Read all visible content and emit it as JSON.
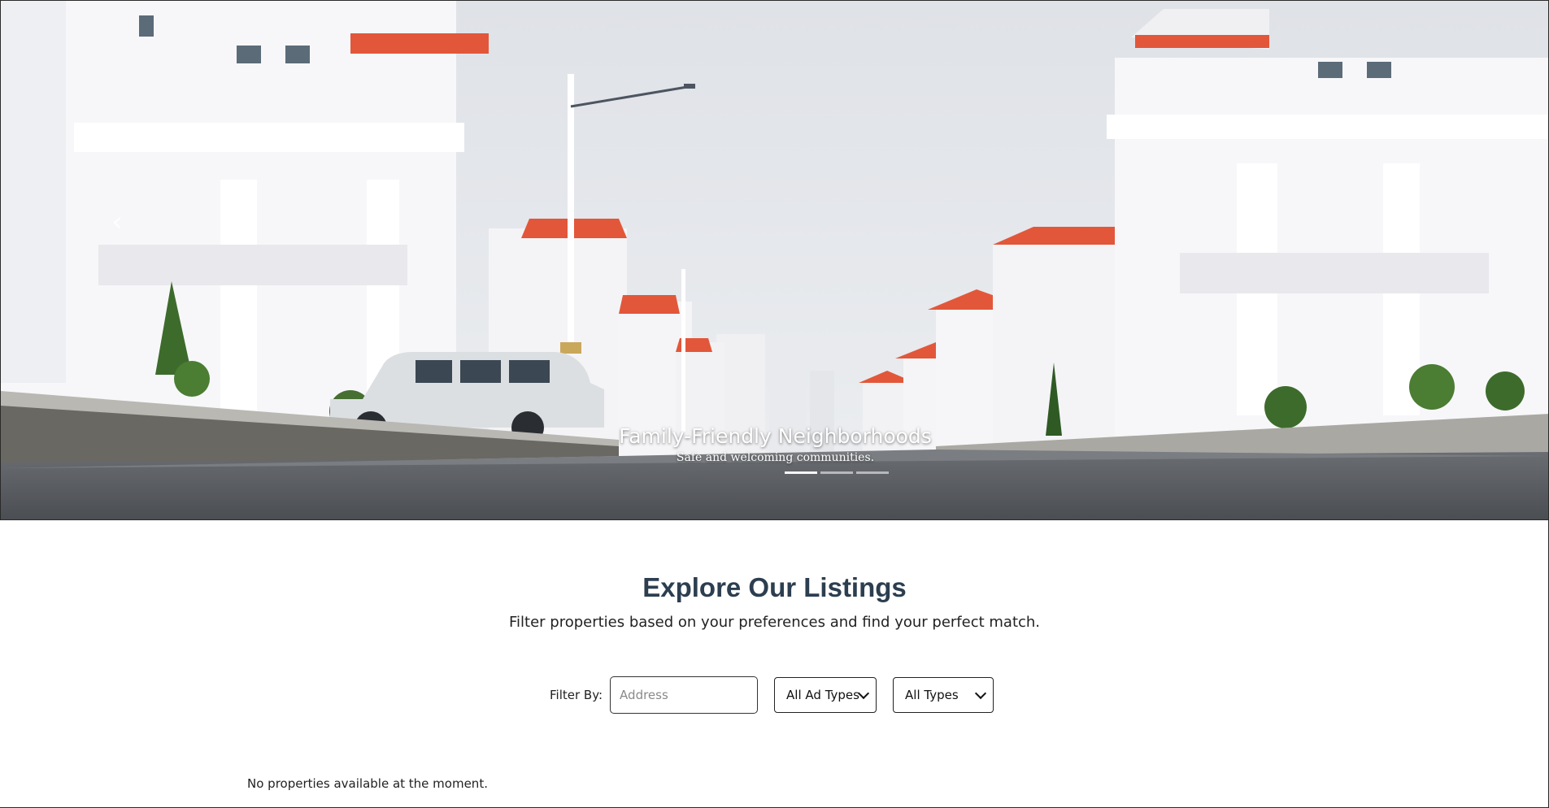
{
  "hero": {
    "slide_title": "Family-Friendly Neighborhoods",
    "slide_subtitle": "Safe and welcoming communities.",
    "prev_glyph": "‹",
    "next_glyph": "›",
    "indicator_count": 3,
    "active_indicator": 0,
    "colors": {
      "sky": "#e6e8ec",
      "roof": "#e2573a",
      "wall": "#f4f4f6",
      "road": "#575a5e",
      "greenery": "#3d6b2c"
    }
  },
  "listings": {
    "title": "Explore Our Listings",
    "subtitle": "Filter properties based on your preferences and find your perfect match.",
    "title_color": "#2c3e50"
  },
  "filters": {
    "label": "Filter By:",
    "address_placeholder": "Address",
    "address_value": "",
    "ad_type_selected": "All Ad Types",
    "type_selected": "All Types"
  },
  "results": {
    "empty_message": "No properties available at the moment."
  }
}
